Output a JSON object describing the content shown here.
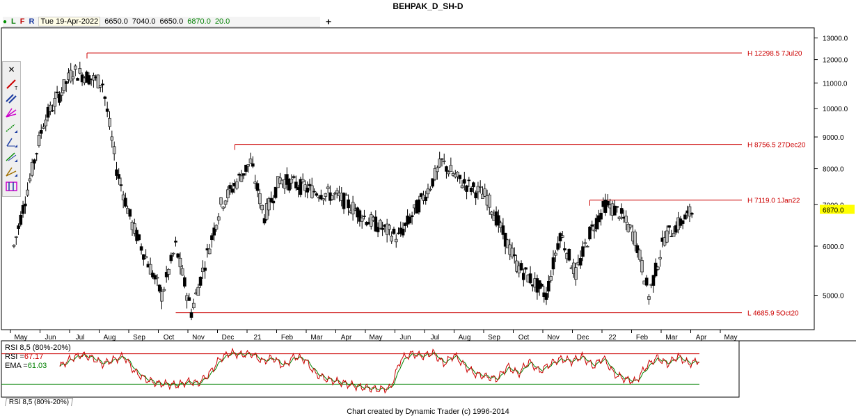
{
  "header": {
    "title": "BEHPAK_D_SH-D"
  },
  "infobar": {
    "flags": [
      "L",
      "F",
      "R"
    ],
    "date": "Tue 19-Apr-2022",
    "open": "6650.0",
    "high": "7040.0",
    "low": "6650.0",
    "close": "6870.0",
    "change": "20.0",
    "add_label": "+"
  },
  "colors": {
    "level_line": "#cc0000",
    "level_text": "#cc0000",
    "bar": "#000000",
    "up_candle_fill": "#bdbdbd",
    "rsi_line": "#cc0000",
    "ema_line": "#008000",
    "price_tag_bg": "#ffff00"
  },
  "toolbar": {
    "icons": [
      "trendline-icon",
      "parallel-lines-icon",
      "fan-icon",
      "fib-b-icon",
      "fib-r-icon",
      "fib-r2-icon",
      "gann-icon",
      "time-tool-icon"
    ]
  },
  "rsi_panel": {
    "label": "RSI 8,5 (80%-20%)",
    "rsi_label": "RSI =",
    "rsi_value": "67.17",
    "ema_label": "EMA =",
    "ema_value": "61.03",
    "tab_label": "RSI 8,5 (80%-20%)"
  },
  "footer": {
    "credit": "Chart created by Dynamic Trader  (c) 1996-2014"
  },
  "chart_data": {
    "type": "bar",
    "title": "BEHPAK_D_SH-D",
    "y_scale": "log",
    "ylim": [
      4400,
      13500
    ],
    "y_ticks": [
      "13000.0",
      "12000.0",
      "11000.0",
      "10000.0",
      "9000.0",
      "8000.0",
      "7000.0",
      "6000.0",
      "5000.0"
    ],
    "y_tick_values": [
      13000,
      12000,
      11000,
      10000,
      9000,
      8000,
      7000,
      6000,
      5000
    ],
    "last_price_label": "6870.0",
    "last_price": 6870,
    "x_months": [
      "May",
      "Jun",
      "Jul",
      "Aug",
      "Sep",
      "Oct",
      "Nov",
      "Dec",
      "21",
      "Feb",
      "Mar",
      "Apr",
      "May",
      "Jun",
      "Jul",
      "Aug",
      "Sep",
      "Oct",
      "Nov",
      "Dec",
      "22",
      "Feb",
      "Mar",
      "Apr",
      "May"
    ],
    "levels": [
      {
        "label": "H 12298.5 7Jul20",
        "value": 12298.5,
        "start_month": "Jul"
      },
      {
        "label": "H 8756.5 27Dec20",
        "value": 8756.5,
        "start_month": "Dec"
      },
      {
        "label": "H 7119.0 1Jan22",
        "value": 7119.0,
        "start_month": "Dec"
      },
      {
        "label": "L 4685.9 5Oct20",
        "value": 4685.9,
        "start_month": "Oct"
      }
    ],
    "price_path": [
      {
        "month": "May",
        "close": 6000
      },
      {
        "month": "Jun",
        "close": 9500
      },
      {
        "month": "Jul",
        "close": 11500
      },
      {
        "month": "Aug",
        "close": 11000
      },
      {
        "month": "Aug",
        "close": 8000
      },
      {
        "month": "Sep",
        "close": 6500
      },
      {
        "month": "Oct",
        "close": 5000
      },
      {
        "month": "Oct",
        "close": 6000
      },
      {
        "month": "Nov",
        "close": 4700
      },
      {
        "month": "Dec",
        "close": 7000
      },
      {
        "month": "21",
        "close": 8200
      },
      {
        "month": "21",
        "close": 6700
      },
      {
        "month": "Feb",
        "close": 7700
      },
      {
        "month": "Mar",
        "close": 7400
      },
      {
        "month": "Apr",
        "close": 7200
      },
      {
        "month": "May",
        "close": 6600
      },
      {
        "month": "Jun",
        "close": 6200
      },
      {
        "month": "Jul",
        "close": 7400
      },
      {
        "month": "Jul",
        "close": 8200
      },
      {
        "month": "Aug",
        "close": 7700
      },
      {
        "month": "Sep",
        "close": 7200
      },
      {
        "month": "Oct",
        "close": 5600
      },
      {
        "month": "Nov",
        "close": 5000
      },
      {
        "month": "Nov",
        "close": 6300
      },
      {
        "month": "Dec",
        "close": 5400
      },
      {
        "month": "Dec",
        "close": 6300
      },
      {
        "month": "22",
        "close": 7000
      },
      {
        "month": "22",
        "close": 6800
      },
      {
        "month": "Feb",
        "close": 6200
      },
      {
        "month": "Feb",
        "close": 5000
      },
      {
        "month": "Mar",
        "close": 6200
      },
      {
        "month": "Apr",
        "close": 6870
      }
    ],
    "rsi": {
      "overbought": 80,
      "oversold": 20,
      "last_rsi": 67.17,
      "last_ema": 61.03,
      "path": [
        55,
        70,
        78,
        72,
        60,
        68,
        75,
        45,
        30,
        22,
        20,
        18,
        25,
        22,
        40,
        70,
        82,
        78,
        80,
        65,
        72,
        55,
        75,
        68,
        40,
        30,
        25,
        20,
        15,
        12,
        10,
        12,
        70,
        80,
        75,
        82,
        60,
        78,
        55,
        40,
        35,
        30,
        55,
        40,
        65,
        45,
        60,
        70,
        65,
        75,
        55,
        72,
        40,
        30,
        25,
        55,
        72,
        60,
        75,
        60,
        67
      ]
    }
  }
}
